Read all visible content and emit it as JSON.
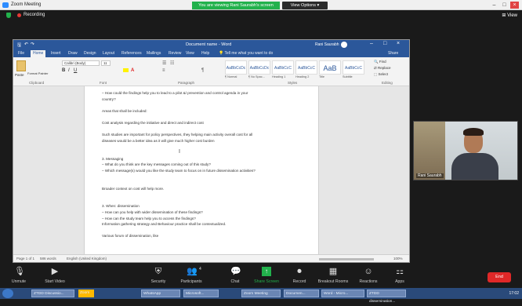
{
  "zoom_window": {
    "title": "Zoom Meeting",
    "share_banner": "You are viewing Rani Saurabh's screen",
    "view_options": "View Options"
  },
  "topbar": {
    "recording": "Recording",
    "view": "View"
  },
  "word": {
    "title": "Document name - Word",
    "user": "Rani Saurabh",
    "tabs": [
      "File",
      "Home",
      "Insert",
      "Draw",
      "Design",
      "Layout",
      "References",
      "Mailings",
      "Review",
      "View",
      "Help"
    ],
    "tell_me": "Tell me what you want to do",
    "share": "Share",
    "ribbon_groups": [
      "Clipboard",
      "Font",
      "Paragraph",
      "Styles",
      "Editing"
    ],
    "paste_label": "Paste",
    "format_painter": "Format Painter",
    "font_name": "Calibri (Body)",
    "font_size": "11",
    "styles": [
      "AaBbCcDc",
      "AaBbCcDc",
      "AaBbCcC",
      "AaBbCcC",
      "AaB",
      "AaBbCcC"
    ],
    "style_names": [
      "¶ Normal",
      "¶ No Spac...",
      "Heading 1",
      "Heading 2",
      "Title",
      "Subtitle"
    ],
    "editing": [
      "Find",
      "Replace",
      "Select"
    ]
  },
  "document_lines": [
    "– How could the findings help you to lead to a pilot  &/ prevention and control agenda in your",
    "country?",
    "",
    "Areas that shall be included:",
    "",
    "Cost analysis regarding the initiative and direct and indirect cost",
    "",
    "Such studies are important for policy perspectives, they helping main activity overall cost for all",
    "diseases would be a better idea as it will give much higher cost burden",
    "",
    "",
    "3. Messaging",
    "– What do you think are the key messages coming out of this study?",
    "– Which message(s) would you like the study team to focus on in future dissemination activities?",
    "",
    "",
    "Broader context on cost will help more.",
    "",
    "",
    "3. When: dissemination",
    "– How can you help with wider dissemination of these findings?",
    "– How can the study team help you to access the findings?",
    "Information gathering strategy and Behaviour practice shall be contextualized.",
    "",
    "Various forum of dissemination, like"
  ],
  "statusbar": {
    "page": "Page 1 of 1",
    "words": "586 words",
    "language": "English (United Kingdom)",
    "zoom": "100%"
  },
  "video": {
    "participant": "Rani Saurabh"
  },
  "toolbar": {
    "unmute": "Unmute",
    "start_video": "Start Video",
    "security": "Security",
    "participants": "Participants",
    "participants_count": "4",
    "chat": "Chat",
    "share_screen": "Share Screen",
    "record": "Record",
    "breakout": "Breakout Rooms",
    "reactions": "Reactions",
    "apps": "Apps",
    "end": "End"
  },
  "taskbar": {
    "items": [
      "ZTDD Discussio...",
      "Zoom",
      "Zoom Meeting",
      "Microsoft...",
      "Documen...",
      "Word - Micro...",
      "WhatsApp",
      "3 - Microsoft...",
      "ZTDD dissemination..."
    ],
    "clock": "17:02"
  }
}
